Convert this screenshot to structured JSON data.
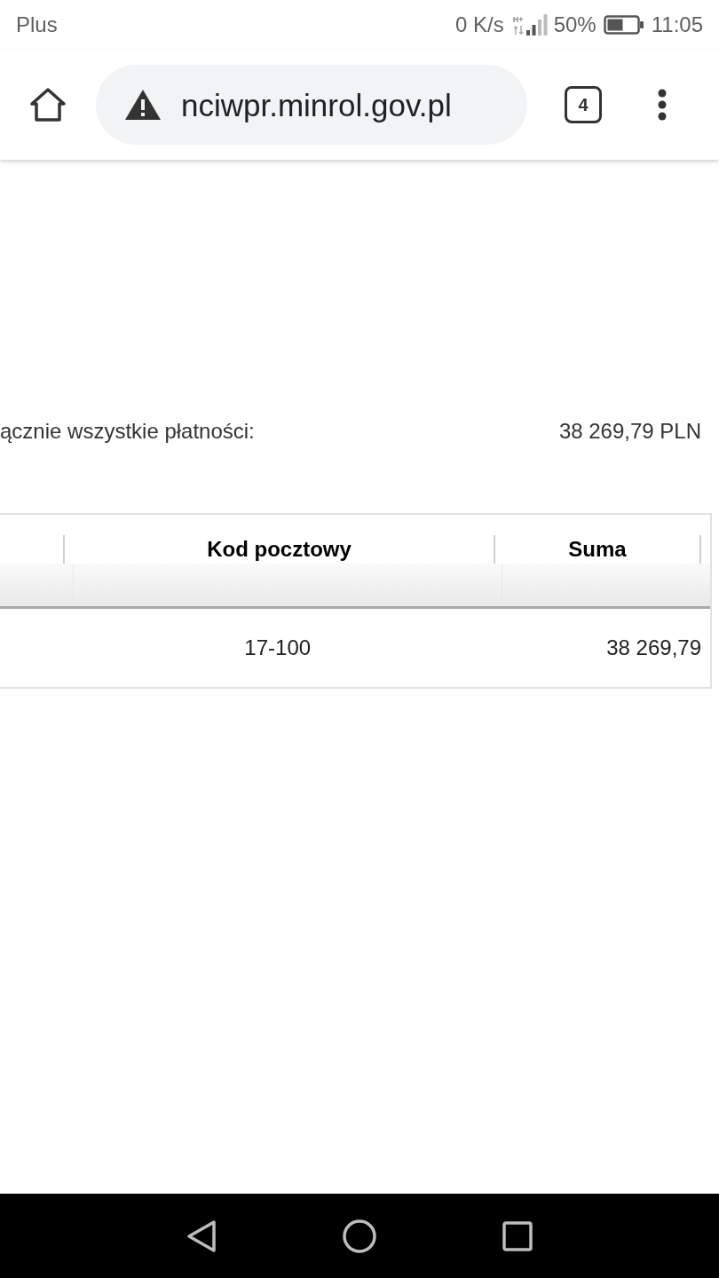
{
  "status_bar": {
    "carrier": "Plus",
    "speed": "0 K/s",
    "network": "H+",
    "battery": "50%",
    "time": "11:05"
  },
  "browser": {
    "url": "nciwpr.minrol.gov.pl",
    "tab_count": "4"
  },
  "summary": {
    "label": "ącznie wszystkie płatności:",
    "value": "38 269,79 PLN"
  },
  "table": {
    "columns": [
      "Kod pocztowy",
      "Suma"
    ],
    "rows": [
      [
        "17-100",
        "38 269,79"
      ]
    ]
  }
}
